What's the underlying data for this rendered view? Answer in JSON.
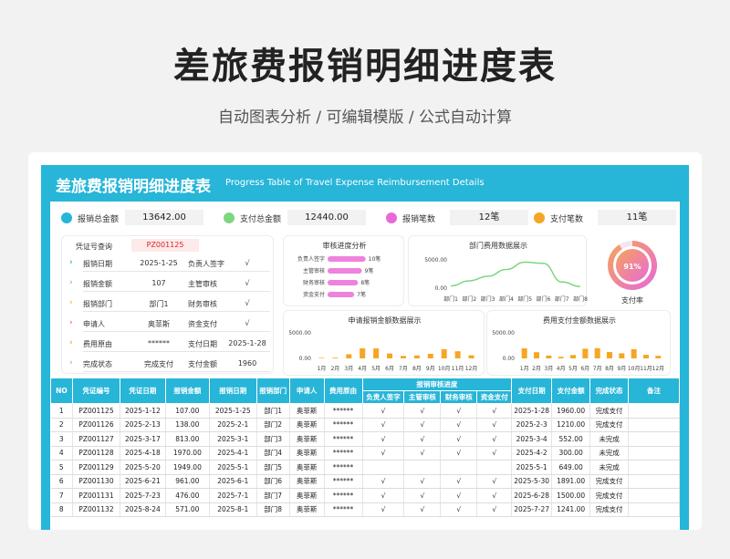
{
  "hero": {
    "title": "差旅费报销明细进度表",
    "subtitle": "自动图表分析 / 可编辑模版 / 公式自动计算"
  },
  "banner": {
    "title": "差旅费报销明细进度表",
    "subtitle": "Progress Table of Travel Expense Reimbursement Details"
  },
  "colors": {
    "accent": "#27b5d8",
    "bar_pink": "#ee82dc",
    "bar_orange": "#f5a623",
    "line_green": "#7ed67e"
  },
  "kpis": [
    {
      "label": "报销总金额",
      "value": "13642.00",
      "color": "#27b5d8"
    },
    {
      "label": "支付总金额",
      "value": "12440.00",
      "color": "#7ed67e"
    },
    {
      "label": "报销笔数",
      "value": "12笔",
      "color": "#e86ad6"
    },
    {
      "label": "支付笔数",
      "value": "11笔",
      "color": "#f5a623"
    }
  ],
  "voucher": {
    "query_label": "凭证号查询",
    "query_value": "PZ001125",
    "rows": [
      {
        "label": "报销日期",
        "value": "2025-1-25",
        "label2": "负责人签字",
        "value2": "√",
        "chev_color": "#27b5d8"
      },
      {
        "label": "报销金额",
        "value": "107",
        "label2": "主管审核",
        "value2": "√",
        "chev_color": "#7ed67e"
      },
      {
        "label": "报销部门",
        "value": "部门1",
        "label2": "财务审核",
        "value2": "√",
        "chev_color": "#f5c023"
      },
      {
        "label": "申请人",
        "value": "奥菲斯",
        "label2": "资金支付",
        "value2": "√",
        "chev_color": "#e86ad6"
      },
      {
        "label": "费用原由",
        "value": "******",
        "label2": "支付日期",
        "value2": "2025-1-28",
        "chev_color": "#f5a623"
      },
      {
        "label": "完成状态",
        "value": "完成支付",
        "label2": "支付金额",
        "value2": "1960",
        "chev_color": "#7ed67e"
      }
    ]
  },
  "chart_data": [
    {
      "type": "bar",
      "title": "审核进度分析",
      "orientation": "horizontal",
      "categories": [
        "负责人签字",
        "主管审核",
        "财务审核",
        "资金支付"
      ],
      "values": [
        10,
        9,
        8,
        7
      ],
      "value_labels": [
        "10笔",
        "9笔",
        "8笔",
        "7笔"
      ],
      "xlim": [
        0,
        12
      ]
    },
    {
      "type": "line",
      "title": "部门费用数据展示",
      "categories": [
        "部门1",
        "部门2",
        "部门3",
        "部门4",
        "部门5",
        "部门6",
        "部门7",
        "部门8"
      ],
      "values": [
        400,
        1300,
        2100,
        3300,
        4600,
        4400,
        1100,
        300
      ],
      "ytick_labels": [
        "5000.00",
        "0.00"
      ],
      "ylim": [
        0,
        5000
      ]
    },
    {
      "type": "bar",
      "title": "申请报销金额数据展示",
      "categories": [
        "1月",
        "2月",
        "3月",
        "4月",
        "5月",
        "6月",
        "7月",
        "8月",
        "9月",
        "10月",
        "11月",
        "12月"
      ],
      "values": [
        107,
        138,
        813,
        1970,
        1949,
        961,
        476,
        571,
        900,
        1800,
        1400,
        600
      ],
      "ytick_labels": [
        "5000.00",
        "0.00"
      ],
      "ylim": [
        0,
        5000
      ]
    },
    {
      "type": "bar",
      "title": "费用支付金额数据展示",
      "categories": [
        "1月",
        "2月",
        "3月",
        "4月",
        "5月",
        "6月",
        "7月",
        "8月",
        "9月",
        "10月",
        "11月",
        "12月"
      ],
      "values": [
        1960,
        1210,
        552,
        300,
        649,
        1891,
        2000,
        1241,
        1000,
        1800,
        700,
        500
      ],
      "ytick_labels": [
        "5000.00",
        "0.00"
      ],
      "ylim": [
        0,
        5000
      ]
    }
  ],
  "gauge": {
    "value": 91,
    "percent_label": "91%",
    "label": "支付率"
  },
  "table": {
    "group_header": "报销审核进度",
    "headers": [
      "NO",
      "凭证编号",
      "凭证日期",
      "报销金额",
      "报销日期",
      "报销部门",
      "申请人",
      "费用原由"
    ],
    "sub_headers": [
      "负责人签字",
      "主管审核",
      "财务审核",
      "资金支付"
    ],
    "tail_headers": [
      "支付日期",
      "支付金额",
      "完成状态",
      "备注"
    ],
    "rows": [
      [
        "1",
        "PZ001125",
        "2025-1-12",
        "107.00",
        "2025-1-25",
        "部门1",
        "奥菲斯",
        "******",
        "√",
        "√",
        "√",
        "√",
        "2025-1-28",
        "1960.00",
        "完成支付",
        ""
      ],
      [
        "2",
        "PZ001126",
        "2025-2-13",
        "138.00",
        "2025-2-1",
        "部门2",
        "奥菲斯",
        "******",
        "√",
        "√",
        "√",
        "√",
        "2025-2-3",
        "1210.00",
        "完成支付",
        ""
      ],
      [
        "3",
        "PZ001127",
        "2025-3-17",
        "813.00",
        "2025-3-1",
        "部门3",
        "奥菲斯",
        "******",
        "√",
        "√",
        "√",
        "√",
        "2025-3-4",
        "552.00",
        "未完成",
        ""
      ],
      [
        "4",
        "PZ001128",
        "2025-4-18",
        "1970.00",
        "2025-4-1",
        "部门4",
        "奥菲斯",
        "******",
        "√",
        "√",
        "√",
        "√",
        "2025-4-2",
        "300.00",
        "未完成",
        ""
      ],
      [
        "5",
        "PZ001129",
        "2025-5-20",
        "1949.00",
        "2025-5-1",
        "部门5",
        "奥菲斯",
        "******",
        "",
        "",
        "",
        "",
        "2025-5-1",
        "649.00",
        "未完成",
        ""
      ],
      [
        "6",
        "PZ001130",
        "2025-6-21",
        "961.00",
        "2025-6-1",
        "部门6",
        "奥菲斯",
        "******",
        "√",
        "√",
        "√",
        "√",
        "2025-5-30",
        "1891.00",
        "完成支付",
        ""
      ],
      [
        "7",
        "PZ001131",
        "2025-7-23",
        "476.00",
        "2025-7-1",
        "部门7",
        "奥菲斯",
        "******",
        "√",
        "√",
        "√",
        "√",
        "2025-6-28",
        "1500.00",
        "完成支付",
        ""
      ],
      [
        "8",
        "PZ001132",
        "2025-8-24",
        "571.00",
        "2025-8-1",
        "部门8",
        "奥菲斯",
        "******",
        "√",
        "√",
        "√",
        "√",
        "2025-7-27",
        "1241.00",
        "完成支付",
        ""
      ]
    ]
  }
}
